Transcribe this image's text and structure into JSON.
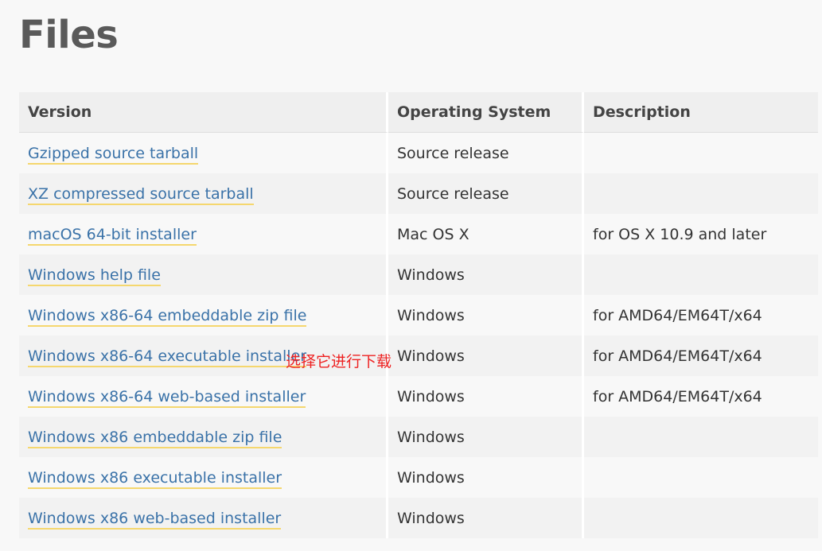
{
  "page": {
    "title": "Files"
  },
  "table": {
    "headers": {
      "version": "Version",
      "os": "Operating System",
      "description": "Description"
    },
    "rows": [
      {
        "version": "Gzipped source tarball",
        "os": "Source release",
        "description": ""
      },
      {
        "version": "XZ compressed source tarball",
        "os": "Source release",
        "description": ""
      },
      {
        "version": "macOS 64-bit installer",
        "os": "Mac OS X",
        "description": "for OS X 10.9 and later"
      },
      {
        "version": "Windows help file",
        "os": "Windows",
        "description": ""
      },
      {
        "version": "Windows x86-64 embeddable zip file",
        "os": "Windows",
        "description": "for AMD64/EM64T/x64"
      },
      {
        "version": "Windows x86-64 executable installer",
        "os": "Windows",
        "description": "for AMD64/EM64T/x64"
      },
      {
        "version": "Windows x86-64 web-based installer",
        "os": "Windows",
        "description": "for AMD64/EM64T/x64"
      },
      {
        "version": "Windows x86 embeddable zip file",
        "os": "Windows",
        "description": ""
      },
      {
        "version": "Windows x86 executable installer",
        "os": "Windows",
        "description": ""
      },
      {
        "version": "Windows x86 web-based installer",
        "os": "Windows",
        "description": ""
      }
    ]
  },
  "annotation": {
    "text": "选择它进行下载",
    "color": "#ee2222"
  },
  "colors": {
    "link": "#3a72a8",
    "link_underline": "#f5d76e",
    "title": "#5a5a5a"
  }
}
